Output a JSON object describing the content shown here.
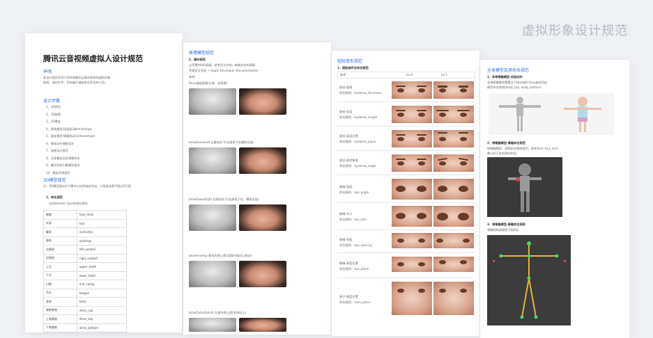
{
  "header": {
    "title": "虚拟形象设计规范"
  },
  "doc1": {
    "title": "腾讯云音视频虚拟人设计规范",
    "s1_title": "声明",
    "s1_text1": "本设计规范仅用于SDK和腾讯云服务相关的虚拟形象",
    "s1_text2": "使用，请勿外传。如有疑问请联系技术支持人员。",
    "s2_title": "设计步骤",
    "steps": [
      "1、3D造型",
      "2、3D绑骨",
      "3、3D蒙皮",
      "4、表情模型/动画驱动blendshape",
      "5、面部模型/骨骼驱动与blendshape",
      "6、肢体动作捕捉设计",
      "7、贴图设计规范",
      "8、全身模型及其骨骼命名",
      "9、腾讯特效引擎模型要求",
      "10、输出资源规范"
    ],
    "s3_title": "3D模型规范",
    "s3_text": "注：3D模型建议在引擎中以自然姿态导出，三角面总数不超过5万面",
    "s3_sub": "1、命名规范",
    "s3_sub2": "对应blender face的命名规则",
    "table": [
      [
        "眼球",
        "face_main"
      ],
      [
        "头发",
        "hair"
      ],
      [
        "睫毛",
        "eyelashes"
      ],
      [
        "眉毛",
        "eyebrow"
      ],
      [
        "左眼球",
        "left_eyeball"
      ],
      [
        "右眼球",
        "right_eyeball"
      ],
      [
        "上牙",
        "upper_teeth"
      ],
      [
        "下牙",
        "lower_teeth"
      ],
      [
        "口腔",
        "oral_cavity"
      ],
      [
        "舌头",
        "tongue"
      ],
      [
        "身体",
        "body"
      ],
      [
        "服装套装",
        "dress_suit"
      ],
      [
        "上装服装",
        "dress_top"
      ],
      [
        "下装服装",
        "dress_bottom"
      ]
    ]
  },
  "doc2": {
    "title": "表情模型规范",
    "sub1": "1、操作规范",
    "line1": "以苹果ARKit表情，参考官方文档，来做对应的表情",
    "link": "苹果官方文档 → Apple Developer Documentation",
    "ref": "参考：",
    "cap0": "Base基础表情(头像、无表情)",
    "cap1": "browDownLeft 左眉毛向下(左眉毛下拉模拟压低)",
    "cap2": "browDownRight 右眉毛向下(右眉毛下拉，模拟压低)",
    "cap3": "browInnerUp 眉毛内侧上提(双眉内侧向上移动)",
    "cap4": "browOuterUpLeft 左眉外侧上提(外侧向上)"
  },
  "doc3": {
    "title": "捏脸变形规范",
    "sub1": "1、捏脸部件及命名规范",
    "col_head": [
      "部件",
      "bs-0",
      "bs-1"
    ],
    "rows": [
      [
        "眉毛-粗细",
        "命名规则：eyebrow_thickness"
      ],
      [
        "眉毛-长度",
        "命名规则：eyebrow_length"
      ],
      [
        "眉毛-高度位置",
        "命名规则：eyebrow_place"
      ],
      [
        "眉毛-旋转角度",
        "命名规则：eyebrow_angle"
      ],
      [
        "眼睛-角度",
        "命名规则：eye_angle"
      ],
      [
        "眼睛-大小",
        "命名规则：eye_size"
      ],
      [
        "眼睛-间距",
        "命名规则：eye_spacing"
      ],
      [
        "眼睛-高度位置",
        "命名规则：eye_place"
      ],
      [
        "鼻子-高度位置",
        "命名规则：nose_place"
      ]
    ]
  },
  "doc4": {
    "title": "全身模型及其命名规范",
    "sub1": "1、非带骨骼模型-初始动作",
    "text1": "非带骨骼模型需要以T-Pose或A-Pose姿态导出",
    "text1b": "模型命名规则(body_top, body_bottom)",
    "sub2": "2、带骨骼模型-骨骼命名规范",
    "text2": "带骨骼模型，骨骼命名需按规范，参考(bs0, bs1, bs2)",
    "text2b": "需以如下命名规则命名。",
    "sub3": "3、带骨骼模型-骨骼命名规则",
    "text3": "骨骼结构请参照下图所示"
  }
}
